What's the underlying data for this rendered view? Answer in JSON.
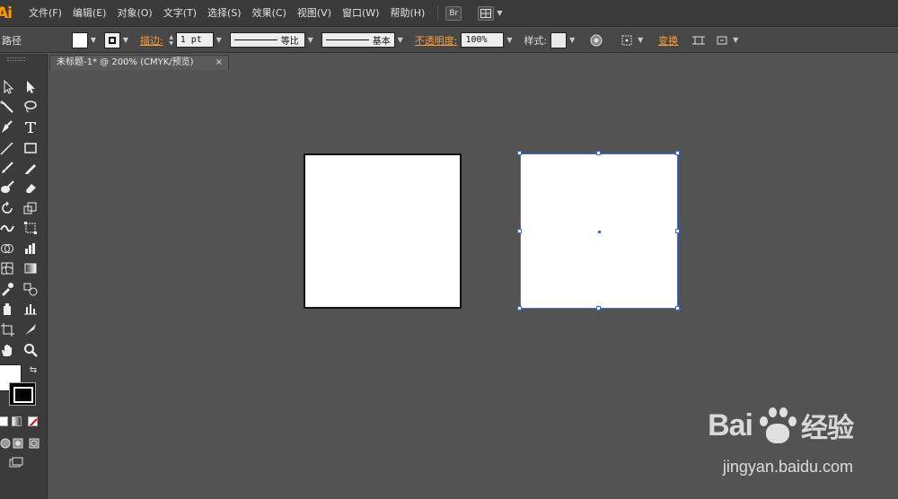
{
  "app": {
    "logo": "Ai",
    "menus": [
      "文件(F)",
      "编辑(E)",
      "对象(O)",
      "文字(T)",
      "选择(S)",
      "效果(C)",
      "视图(V)",
      "窗口(W)",
      "帮助(H)"
    ],
    "bridge_label": "Br"
  },
  "control_bar": {
    "selection_type": "路径",
    "stroke_label": "描边:",
    "stroke_weight": "1 pt",
    "variable_width_label": "等比",
    "brush_label": "基本",
    "opacity_label": "不透明度:",
    "opacity_value": "100%",
    "style_label": "样式:",
    "transform_label": "变换"
  },
  "document": {
    "tab_title": "未标题-1* @ 200% (CMYK/预览)",
    "close_glyph": "×"
  },
  "watermark": {
    "brand_left": "Bai",
    "brand_right": "经验",
    "url": "jingyan.baidu.com"
  },
  "colors": {
    "accent_orange": "#ff9a00",
    "selection_blue": "#3e6ad0",
    "canvas_bg": "#535353"
  }
}
